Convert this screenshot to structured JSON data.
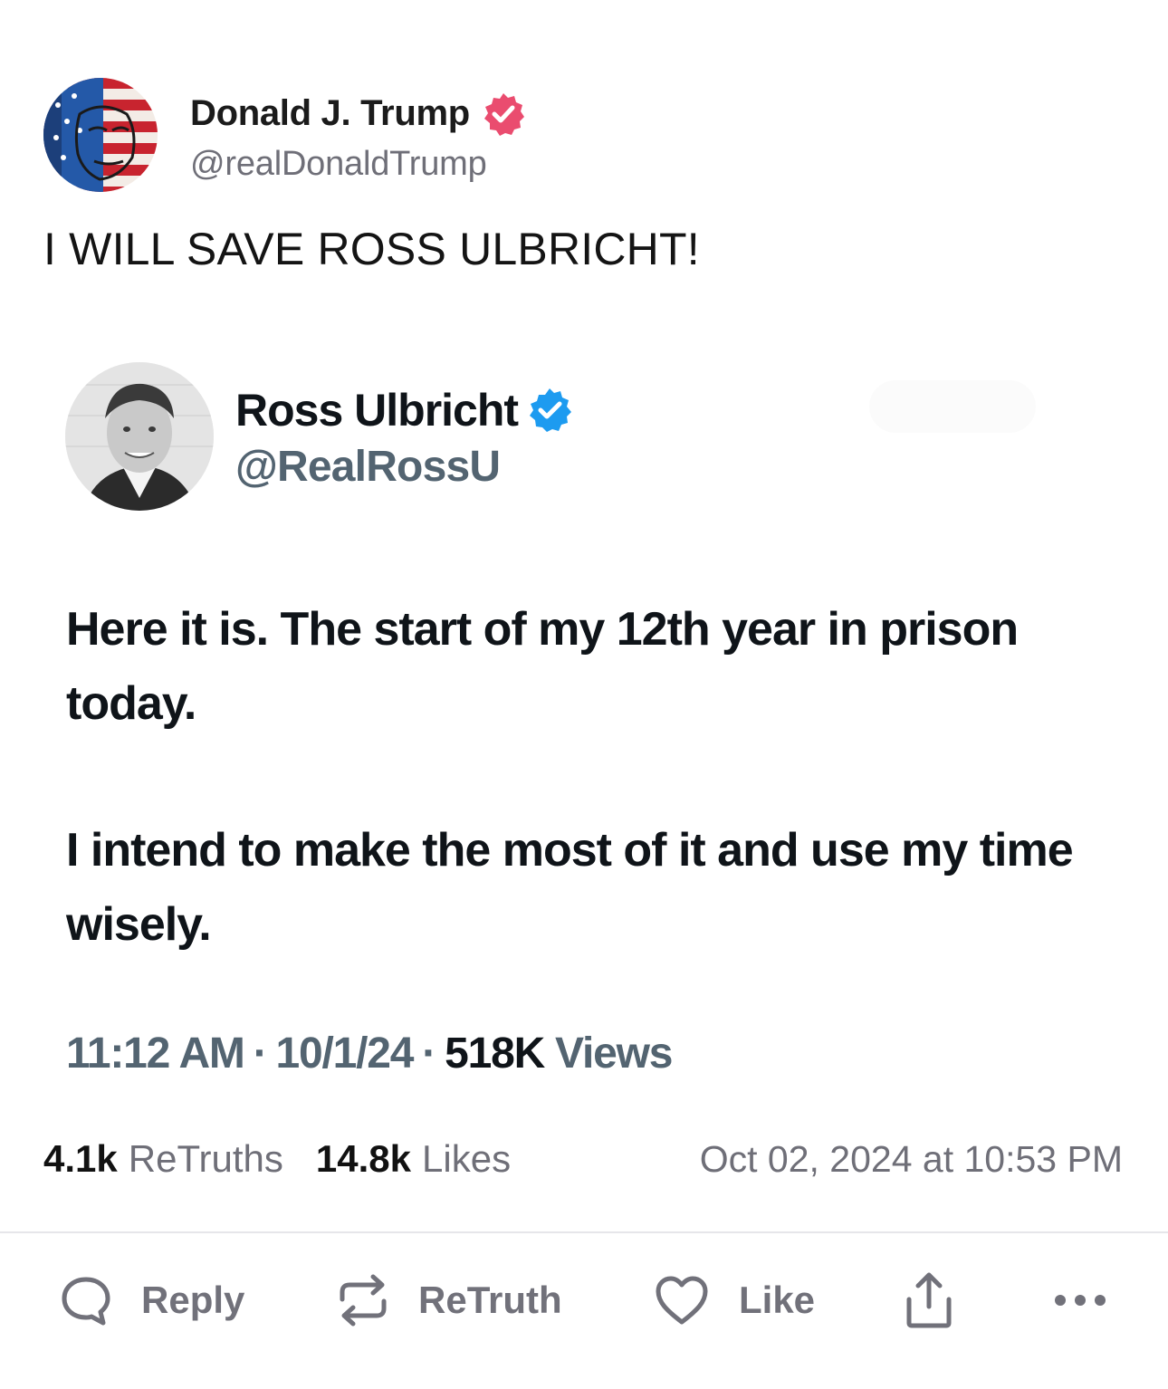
{
  "author": {
    "name": "Donald J. Trump",
    "handle": "@realDonaldTrump"
  },
  "post": {
    "text": "I WILL SAVE ROSS ULBRICHT!"
  },
  "embed": {
    "author_name": "Ross Ulbricht",
    "author_handle": "@RealRossU",
    "paragraphs": [
      "Here it is. The start of my 12th year in prison today.",
      "I intend to make the most of it and use my time wisely."
    ],
    "time": "11:12 AM",
    "date": "10/1/24",
    "separator": "·",
    "views_count": "518K",
    "views_label": "Views"
  },
  "stats": {
    "retruths_count": "4.1k",
    "retruths_label": "ReTruths",
    "likes_count": "14.8k",
    "likes_label": "Likes",
    "timestamp": "Oct 02, 2024 at 10:53 PM"
  },
  "actions": {
    "reply": "Reply",
    "retruth": "ReTruth",
    "like": "Like"
  },
  "colors": {
    "verified_truth": "#ea4c6f",
    "verified_x": "#1d9bf0",
    "muted_text": "#6f6f78",
    "icon_gray": "#71717a"
  },
  "icons": {
    "verified_truth": "verified-badge-icon",
    "verified_x": "verified-badge-icon",
    "reply": "speech-bubble-icon",
    "retruth": "repost-arrows-icon",
    "like": "heart-icon",
    "share": "share-upload-icon",
    "more": "more-dots-icon"
  }
}
